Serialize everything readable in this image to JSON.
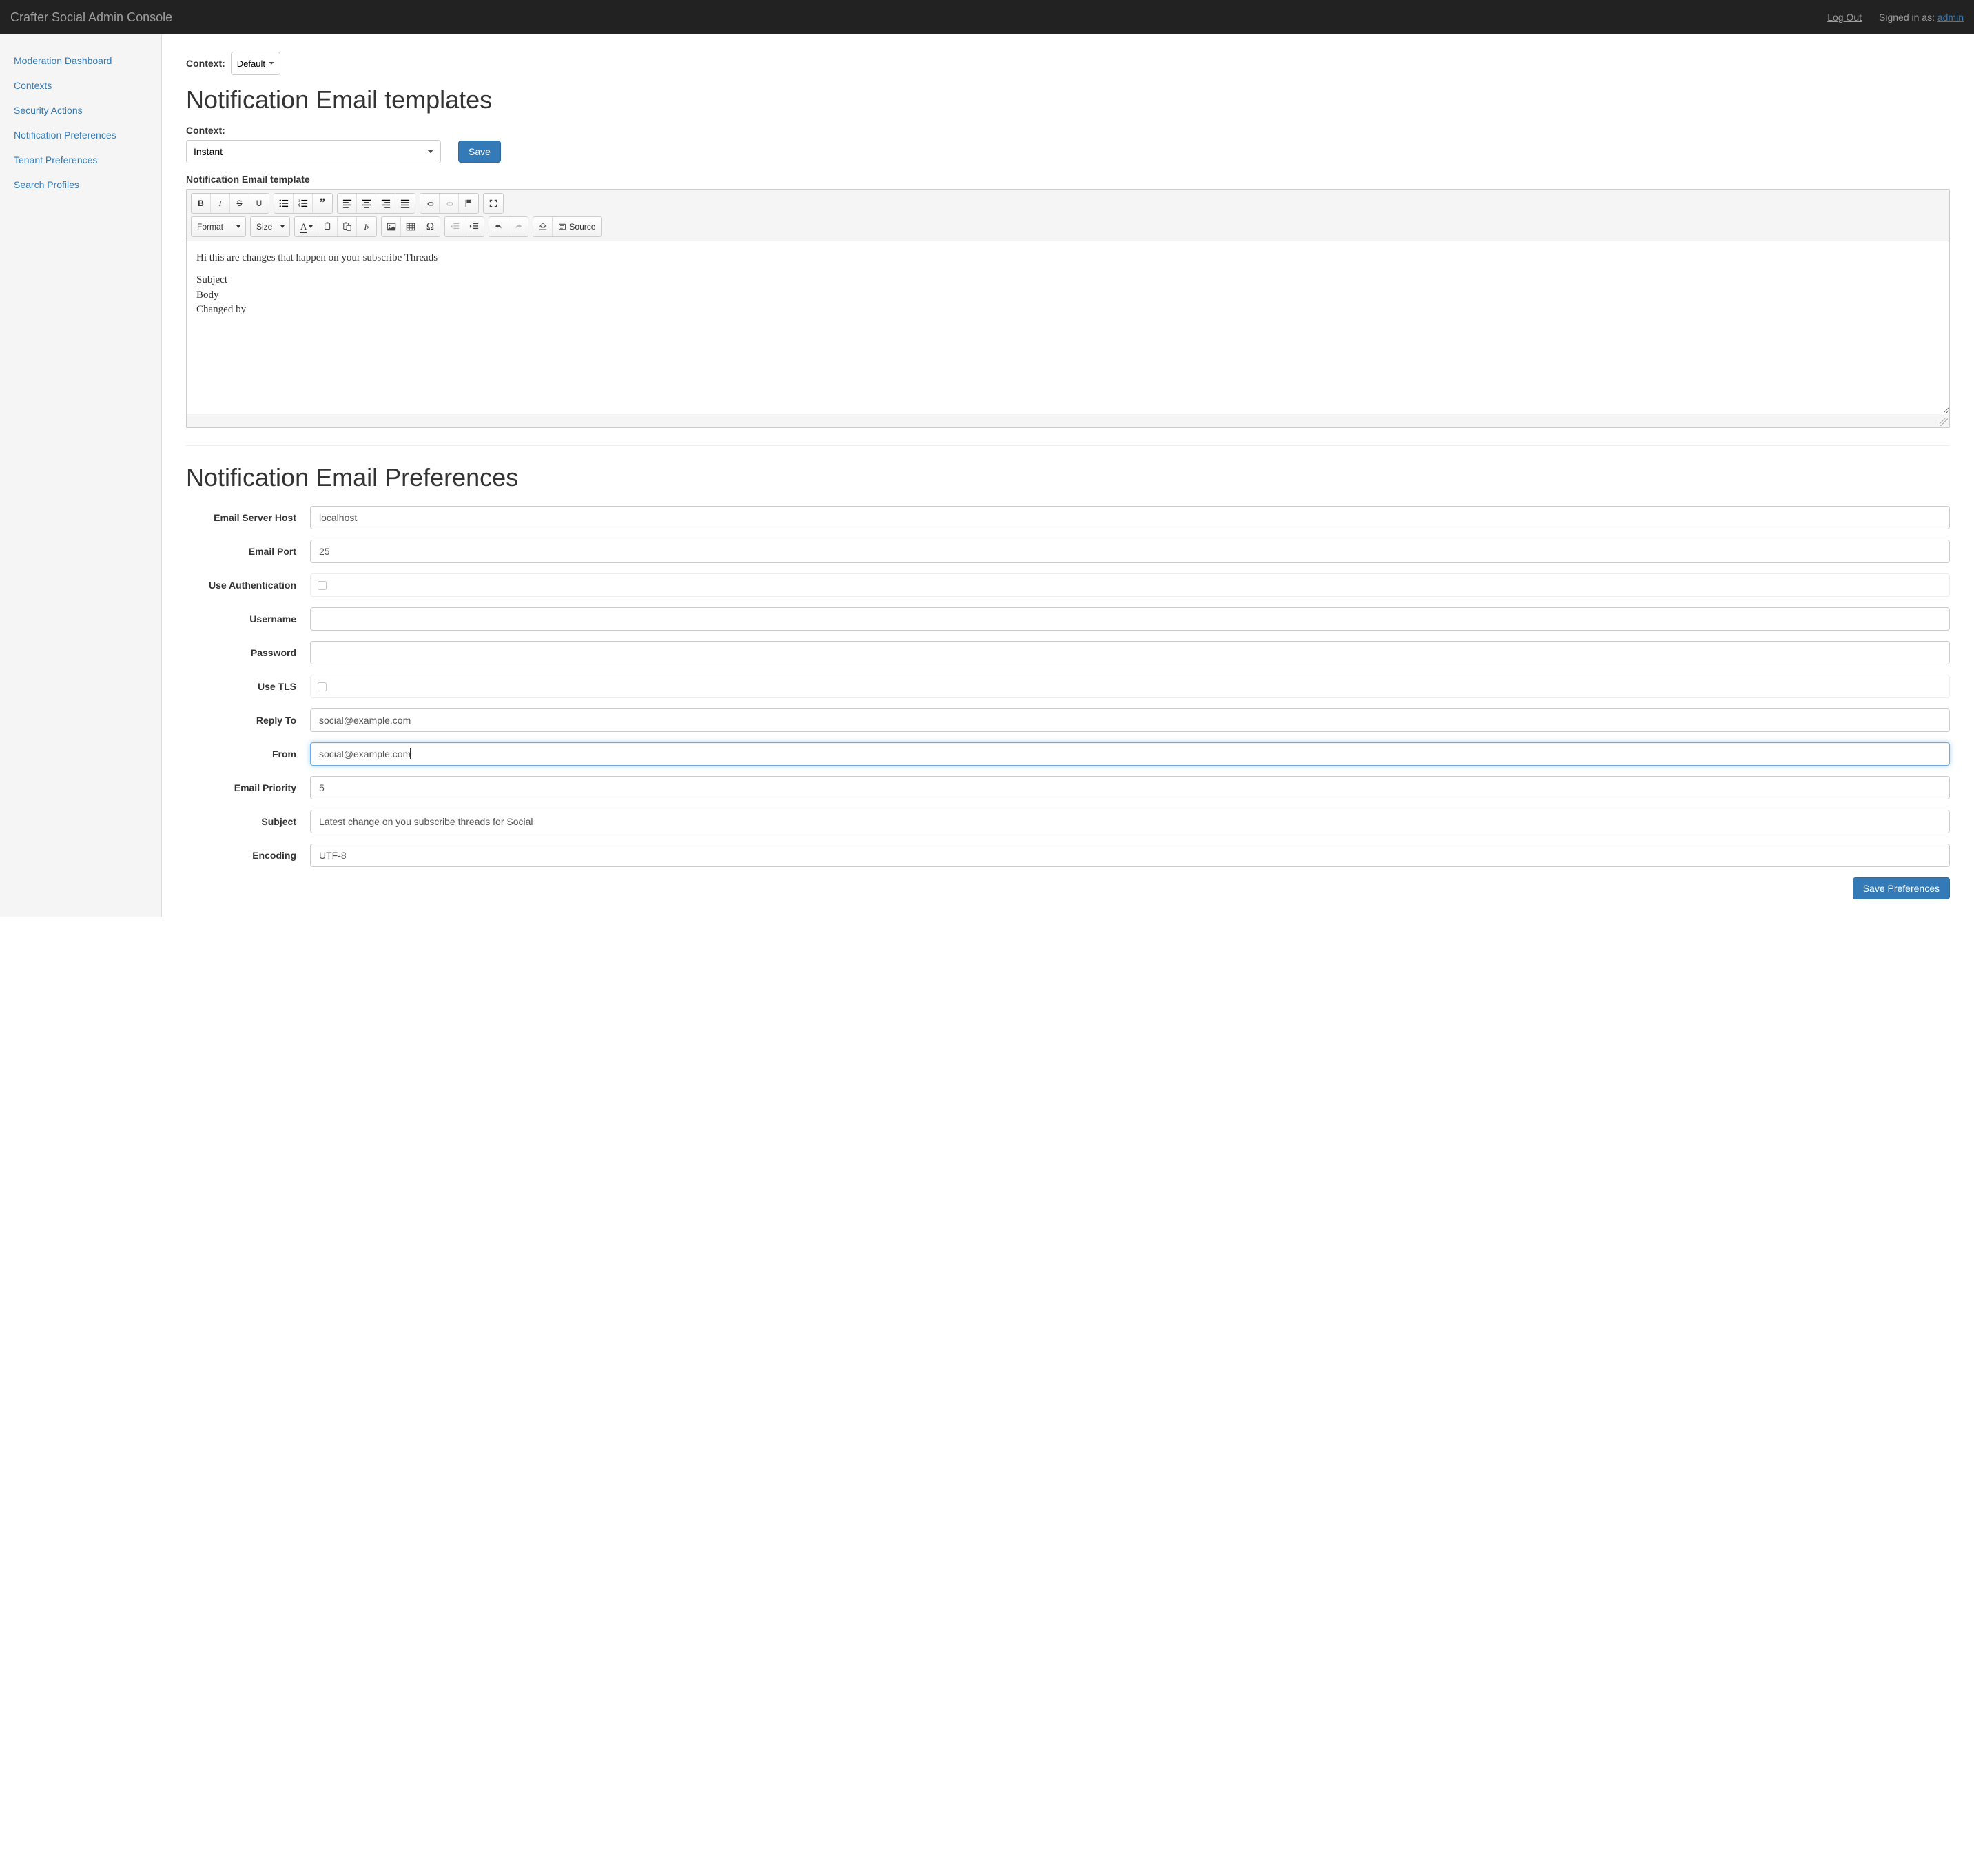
{
  "navbar": {
    "brand": "Crafter Social Admin Console",
    "logout": "Log Out",
    "signed_in_prefix": "Signed in as: ",
    "user": "admin"
  },
  "sidebar": {
    "items": [
      {
        "label": "Moderation Dashboard",
        "name": "sidebar-moderation-dashboard"
      },
      {
        "label": "Contexts",
        "name": "sidebar-contexts"
      },
      {
        "label": "Security Actions",
        "name": "sidebar-security-actions"
      },
      {
        "label": "Notification Preferences",
        "name": "sidebar-notification-preferences"
      },
      {
        "label": "Tenant Preferences",
        "name": "sidebar-tenant-preferences"
      },
      {
        "label": "Search Profiles",
        "name": "sidebar-search-profiles"
      }
    ]
  },
  "context": {
    "label": "Context:",
    "selected": "Default"
  },
  "templates": {
    "heading": "Notification Email templates",
    "context_label": "Context:",
    "context_value": "Instant",
    "save_label": "Save",
    "editor_label": "Notification Email template",
    "toolbar": {
      "format": "Format",
      "size": "Size",
      "source": "Source"
    },
    "body_lines": [
      "Hi this are changes that happen on your subscribe Threads",
      "",
      "Subject",
      "Body",
      "Changed by"
    ]
  },
  "prefs": {
    "heading": "Notification Email Preferences",
    "rows": {
      "host": {
        "label": "Email Server Host",
        "value": "localhost"
      },
      "port": {
        "label": "Email Port",
        "value": "25"
      },
      "auth": {
        "label": "Use Authentication",
        "checked": false
      },
      "username": {
        "label": "Username",
        "value": ""
      },
      "password": {
        "label": "Password",
        "value": ""
      },
      "tls": {
        "label": "Use TLS",
        "checked": false
      },
      "reply_to": {
        "label": "Reply To",
        "value": "social@example.com"
      },
      "from": {
        "label": "From",
        "value": "social@example.com"
      },
      "priority": {
        "label": "Email Priority",
        "value": "5"
      },
      "subject": {
        "label": "Subject",
        "value": "Latest change on you subscribe threads for Social"
      },
      "encoding": {
        "label": "Encoding",
        "value": "UTF-8"
      }
    },
    "save_btn": "Save Preferences"
  }
}
